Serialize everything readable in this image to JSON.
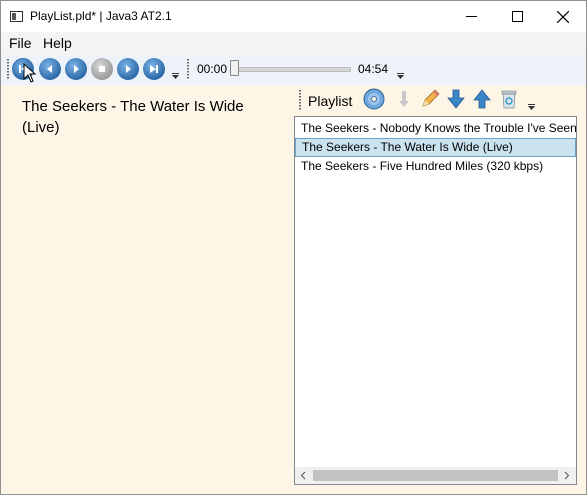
{
  "window": {
    "title": "PlayList.pld* | Java3 AT2.1"
  },
  "menu": {
    "file": "File",
    "help": "Help"
  },
  "player": {
    "current_time": "00:00",
    "total_time": "04:54",
    "progress": 0
  },
  "now_playing": {
    "text": "The Seekers - The Water Is Wide (Live)"
  },
  "playlist": {
    "label": "Playlist",
    "items": [
      {
        "title": "The Seekers - Nobody Knows the Trouble I've Seen"
      },
      {
        "title": "The Seekers - The Water Is Wide (Live)",
        "selected": true
      },
      {
        "title": "The Seekers - Five Hundred Miles (320 kbps)"
      }
    ]
  },
  "colors": {
    "pane_background": "#fdf5e6",
    "toolbar_background": "#eef3fa",
    "selection": "#cbe3ee",
    "button_blue": "#2d6aa8"
  }
}
